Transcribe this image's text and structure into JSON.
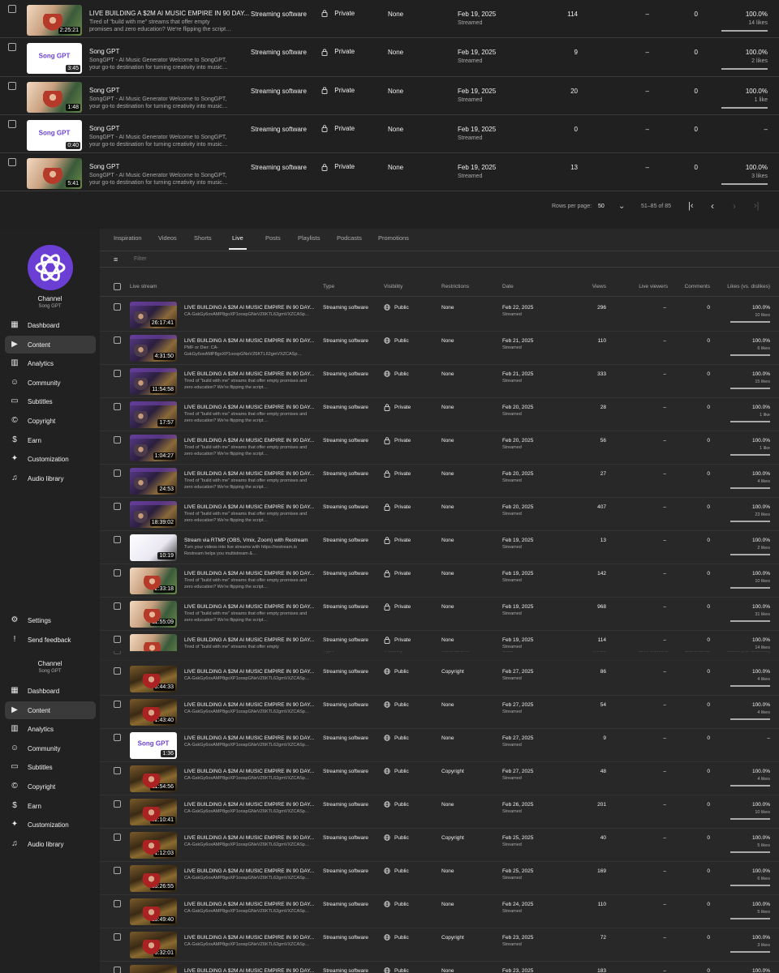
{
  "top_table": {
    "rows": [
      {
        "title": "LIVE BUILDING A $2M AI MUSIC EMPIRE IN 90 DAY...",
        "desc": "Tired of \"build with me\" streams that offer empty promises and zero education? We're flipping the script…",
        "duration": "2:25:21",
        "thumb": "cream",
        "type": "Streaming software",
        "visibility": "Private",
        "restrictions": "None",
        "date": "Feb 19, 2025",
        "date_sub": "Streamed",
        "views": "114",
        "live_viewers": "–",
        "comments": "0",
        "likes": "100.0%",
        "likes_sub": "14 likes",
        "ratio": 1
      },
      {
        "title": "Song GPT",
        "desc": "SongGPT - AI Music Generator Welcome to SongGPT, your go-to destination for turning creativity into music…",
        "duration": "3:45",
        "thumb": "logo",
        "type": "Streaming software",
        "visibility": "Private",
        "restrictions": "None",
        "date": "Feb 19, 2025",
        "date_sub": "Streamed",
        "views": "9",
        "live_viewers": "–",
        "comments": "0",
        "likes": "100.0%",
        "likes_sub": "2 likes",
        "ratio": 1
      },
      {
        "title": "Song GPT",
        "desc": "SongGPT - AI Music Generator Welcome to SongGPT, your go-to destination for turning creativity into music…",
        "duration": "1:48",
        "thumb": "cream",
        "type": "Streaming software",
        "visibility": "Private",
        "restrictions": "None",
        "date": "Feb 19, 2025",
        "date_sub": "Streamed",
        "views": "20",
        "live_viewers": "–",
        "comments": "0",
        "likes": "100.0%",
        "likes_sub": "1 like",
        "ratio": 1
      },
      {
        "title": "Song GPT",
        "desc": "SongGPT - AI Music Generator Welcome to SongGPT, your go-to destination for turning creativity into music…",
        "duration": "0:40",
        "thumb": "logo",
        "type": "Streaming software",
        "visibility": "Private",
        "restrictions": "None",
        "date": "Feb 19, 2025",
        "date_sub": "Streamed",
        "views": "0",
        "live_viewers": "–",
        "comments": "0",
        "likes": "–",
        "likes_sub": "",
        "ratio": null
      },
      {
        "title": "Song GPT",
        "desc": "SongGPT - AI Music Generator Welcome to SongGPT, your go-to destination for turning creativity into music…",
        "duration": "5:41",
        "thumb": "cream",
        "type": "Streaming software",
        "visibility": "Private",
        "restrictions": "None",
        "date": "Feb 19, 2025",
        "date_sub": "Streamed",
        "views": "13",
        "live_viewers": "–",
        "comments": "0",
        "likes": "100.0%",
        "likes_sub": "3 likes",
        "ratio": 1
      }
    ],
    "pager": {
      "rows_per_page_label": "Rows per page:",
      "rows_per_page": "50",
      "range": "51–85 of 85"
    }
  },
  "logo_text": "Song GPT",
  "channel": {
    "label": "Channel",
    "name": "Song GPT"
  },
  "nav": [
    {
      "label": "Dashboard",
      "icon": "dashboard-icon",
      "glyph": "▦"
    },
    {
      "label": "Content",
      "icon": "content-icon",
      "glyph": "▶"
    },
    {
      "label": "Analytics",
      "icon": "analytics-icon",
      "glyph": "▥"
    },
    {
      "label": "Community",
      "icon": "community-icon",
      "glyph": "☺"
    },
    {
      "label": "Subtitles",
      "icon": "subtitles-icon",
      "glyph": "▭"
    },
    {
      "label": "Copyright",
      "icon": "copyright-icon",
      "glyph": "©"
    },
    {
      "label": "Earn",
      "icon": "earn-icon",
      "glyph": "$"
    },
    {
      "label": "Customization",
      "icon": "customization-icon",
      "glyph": "✦"
    },
    {
      "label": "Audio library",
      "icon": "audio-library-icon",
      "glyph": "♫"
    }
  ],
  "nav_bottom": [
    {
      "label": "Settings",
      "icon": "settings-icon",
      "glyph": "⚙"
    },
    {
      "label": "Send feedback",
      "icon": "feedback-icon",
      "glyph": "!"
    }
  ],
  "tabs": [
    "Inspiration",
    "Videos",
    "Shorts",
    "Live",
    "Posts",
    "Playlists",
    "Podcasts",
    "Promotions"
  ],
  "active_tab": "Live",
  "filter_placeholder": "Filter",
  "columns": {
    "live_stream": "Live stream",
    "type": "Type",
    "visibility": "Visibility",
    "restrictions": "Restrictions",
    "date": "Date",
    "views": "Views",
    "live_viewers": "Live viewers",
    "comments": "Comments",
    "likes": "Likes (vs. dislikes)"
  },
  "panel1_rows": [
    {
      "title": "LIVE BUILDING A $2M AI MUSIC EMPIRE IN 90 DAY...",
      "desc": "CA-GskGy6oxAMP8goXP1oospGNeVZ6KTL62gmVXZCASp…",
      "duration": "26:17:41",
      "thumb": "live",
      "type": "Streaming software",
      "visibility": "Public",
      "restrictions": "None",
      "date": "Feb 22, 2025",
      "date_sub": "Streamed",
      "views": "296",
      "live_viewers": "–",
      "comments": "0",
      "likes": "100.0%",
      "likes_sub": "10 likes",
      "ratio": 1
    },
    {
      "title": "LIVE BUILDING A $2M AI MUSIC EMPIRE IN 90 DAY...",
      "desc": "PMF or Dier: CA-GskGy6oxAMP8goXP1oospGNeVZ6KTL62gmVXZCASp…",
      "duration": "4:31:50",
      "thumb": "live",
      "type": "Streaming software",
      "visibility": "Public",
      "restrictions": "None",
      "date": "Feb 21, 2025",
      "date_sub": "Streamed",
      "views": "110",
      "live_viewers": "–",
      "comments": "0",
      "likes": "100.0%",
      "likes_sub": "6 likes",
      "ratio": 1
    },
    {
      "title": "LIVE BUILDING A $2M AI MUSIC EMPIRE IN 90 DAY...",
      "desc": "Tired of \"build with me\" streams that offer empty promises and zero education? We're flipping the script…",
      "duration": "11:54:58",
      "thumb": "live",
      "type": "Streaming software",
      "visibility": "Public",
      "restrictions": "None",
      "date": "Feb 21, 2025",
      "date_sub": "Streamed",
      "views": "333",
      "live_viewers": "–",
      "comments": "0",
      "likes": "100.0%",
      "likes_sub": "15 likes",
      "ratio": 1
    },
    {
      "title": "LIVE BUILDING A $2M AI MUSIC EMPIRE IN 90 DAY...",
      "desc": "Tired of \"build with me\" streams that offer empty promises and zero education? We're flipping the script…",
      "duration": "17:57",
      "thumb": "live",
      "type": "Streaming software",
      "visibility": "Private",
      "restrictions": "None",
      "date": "Feb 20, 2025",
      "date_sub": "Streamed",
      "views": "28",
      "live_viewers": "–",
      "comments": "0",
      "likes": "100.0%",
      "likes_sub": "1 like",
      "ratio": 1
    },
    {
      "title": "LIVE BUILDING A $2M AI MUSIC EMPIRE IN 90 DAY...",
      "desc": "Tired of \"build with me\" streams that offer empty promises and zero education? We're flipping the script…",
      "duration": "1:04:27",
      "thumb": "live",
      "type": "Streaming software",
      "visibility": "Private",
      "restrictions": "None",
      "date": "Feb 20, 2025",
      "date_sub": "Streamed",
      "views": "56",
      "live_viewers": "–",
      "comments": "0",
      "likes": "100.0%",
      "likes_sub": "1 like",
      "ratio": 1
    },
    {
      "title": "LIVE BUILDING A $2M AI MUSIC EMPIRE IN 90 DAY...",
      "desc": "Tired of \"build with me\" streams that offer empty promises and zero education? We're flipping the script…",
      "duration": "24:53",
      "thumb": "live",
      "type": "Streaming software",
      "visibility": "Private",
      "restrictions": "None",
      "date": "Feb 20, 2025",
      "date_sub": "Streamed",
      "views": "27",
      "live_viewers": "–",
      "comments": "0",
      "likes": "100.0%",
      "likes_sub": "4 likes",
      "ratio": 1
    },
    {
      "title": "LIVE BUILDING A $2M AI MUSIC EMPIRE IN 90 DAY...",
      "desc": "Tired of \"build with me\" streams that offer empty promises and zero education? We're flipping the script…",
      "duration": "18:39:02",
      "thumb": "live",
      "type": "Streaming software",
      "visibility": "Private",
      "restrictions": "None",
      "date": "Feb 20, 2025",
      "date_sub": "Streamed",
      "views": "407",
      "live_viewers": "–",
      "comments": "0",
      "likes": "100.0%",
      "likes_sub": "23 likes",
      "ratio": 1
    },
    {
      "title": "Stream via RTMP (OBS, Vmix, Zoom) with Restream",
      "desc": "Turn your videos into live streams with https://restream.io Restream helps you multistream &…",
      "duration": "10:19",
      "thumb": "white",
      "type": "Streaming software",
      "visibility": "Private",
      "restrictions": "None",
      "date": "Feb 19, 2025",
      "date_sub": "Streamed",
      "views": "13",
      "live_viewers": "–",
      "comments": "0",
      "likes": "100.0%",
      "likes_sub": "2 likes",
      "ratio": 1
    },
    {
      "title": "LIVE BUILDING A $2M AI MUSIC EMPIRE IN 90 DAY...",
      "desc": "Tired of \"build with me\" streams that offer empty promises and zero education? We're flipping the script…",
      "duration": "2:33:18",
      "thumb": "cream",
      "type": "Streaming software",
      "visibility": "Private",
      "restrictions": "None",
      "date": "Feb 19, 2025",
      "date_sub": "Streamed",
      "views": "142",
      "live_viewers": "–",
      "comments": "0",
      "likes": "100.0%",
      "likes_sub": "10 likes",
      "ratio": 1
    },
    {
      "title": "LIVE BUILDING A $2M AI MUSIC EMPIRE IN 90 DAY...",
      "desc": "Tired of \"build with me\" streams that offer empty promises and zero education? We're flipping the script…",
      "duration": "11:55:09",
      "thumb": "cream",
      "type": "Streaming software",
      "visibility": "Private",
      "restrictions": "None",
      "date": "Feb 19, 2025",
      "date_sub": "Streamed",
      "views": "968",
      "live_viewers": "–",
      "comments": "0",
      "likes": "100.0%",
      "likes_sub": "31 likes",
      "ratio": 1
    },
    {
      "title": "LIVE BUILDING A $2M AI MUSIC EMPIRE IN 90 DAY...",
      "desc": "Tired of \"build with me\" streams that offer empty",
      "duration": "",
      "thumb": "cream",
      "type": "Streaming software",
      "visibility": "Private",
      "restrictions": "None",
      "date": "Feb 19, 2025",
      "date_sub": "Streamed",
      "views": "114",
      "live_viewers": "–",
      "comments": "0",
      "likes": "100.0%",
      "likes_sub": "14 likes",
      "ratio": 1
    }
  ],
  "panel2_rows": [
    {
      "title": "LIVE BUILDING A $2M AI MUSIC EMPIRE IN 90 DAY...",
      "desc": "CA-GskGy6oxAMP8goXP1oospGNeVZ6KTL62gmVXZCASp…",
      "duration": "8:44:33",
      "thumb": "room",
      "type": "Streaming software",
      "visibility": "Public",
      "restrictions": "Copyright",
      "date": "Feb 27, 2025",
      "date_sub": "Streamed",
      "views": "86",
      "live_viewers": "–",
      "comments": "0",
      "likes": "100.0%",
      "likes_sub": "4 likes",
      "ratio": 1
    },
    {
      "title": "LIVE BUILDING A $2M AI MUSIC EMPIRE IN 90 DAY...",
      "desc": "CA-GskGy6oxAMP8goXP1oospGNeVZ6KTL62gmVXZCASp…",
      "duration": "1:43:40",
      "thumb": "room",
      "type": "Streaming software",
      "visibility": "Public",
      "restrictions": "None",
      "date": "Feb 27, 2025",
      "date_sub": "Streamed",
      "views": "54",
      "live_viewers": "–",
      "comments": "0",
      "likes": "100.0%",
      "likes_sub": "4 likes",
      "ratio": 1
    },
    {
      "title": "LIVE BUILDING A $2M AI MUSIC EMPIRE IN 90 DAY...",
      "desc": "CA-GskGy6oxAMP8goXP1oospGNeVZ6KTL62gmVXZCASp…",
      "duration": "1:36",
      "thumb": "logo",
      "type": "Streaming software",
      "visibility": "Public",
      "restrictions": "None",
      "date": "Feb 27, 2025",
      "date_sub": "Streamed",
      "views": "9",
      "live_viewers": "–",
      "comments": "0",
      "likes": "–",
      "likes_sub": "",
      "ratio": null
    },
    {
      "title": "LIVE BUILDING A $2M AI MUSIC EMPIRE IN 90 DAY...",
      "desc": "CA-GskGy6oxAMP8goXP1oospGNeVZ6KTL62gmVXZCASp…",
      "duration": "11:54:56",
      "thumb": "room",
      "type": "Streaming software",
      "visibility": "Public",
      "restrictions": "Copyright",
      "date": "Feb 27, 2025",
      "date_sub": "Streamed",
      "views": "48",
      "live_viewers": "–",
      "comments": "0",
      "likes": "100.0%",
      "likes_sub": "4 likes",
      "ratio": 1
    },
    {
      "title": "LIVE BUILDING A $2M AI MUSIC EMPIRE IN 90 DAY...",
      "desc": "CA-GskGy6oxAMP8goXP1oospGNeVZ6KTL62gmVXZCASp…",
      "duration": "32:10:41",
      "thumb": "room",
      "type": "Streaming software",
      "visibility": "Public",
      "restrictions": "None",
      "date": "Feb 26, 2025",
      "date_sub": "Streamed",
      "views": "201",
      "live_viewers": "–",
      "comments": "0",
      "likes": "100.0%",
      "likes_sub": "10 likes",
      "ratio": 1
    },
    {
      "title": "LIVE BUILDING A $2M AI MUSIC EMPIRE IN 90 DAY...",
      "desc": "CA-GskGy6oxAMP8goXP1oospGNeVZ6KTL62gmVXZCASp…",
      "duration": "1:12:03",
      "thumb": "room",
      "type": "Streaming software",
      "visibility": "Public",
      "restrictions": "Copyright",
      "date": "Feb 25, 2025",
      "date_sub": "Streamed",
      "views": "40",
      "live_viewers": "–",
      "comments": "0",
      "likes": "100.0%",
      "likes_sub": "5 likes",
      "ratio": 1
    },
    {
      "title": "LIVE BUILDING A $2M AI MUSIC EMPIRE IN 90 DAY...",
      "desc": "CA-GskGy6oxAMP8goXP1oospGNeVZ6KTL62gmVXZCASp…",
      "duration": "23:26:55",
      "thumb": "room",
      "type": "Streaming software",
      "visibility": "Public",
      "restrictions": "None",
      "date": "Feb 25, 2025",
      "date_sub": "Streamed",
      "views": "169",
      "live_viewers": "–",
      "comments": "0",
      "likes": "100.0%",
      "likes_sub": "6 likes",
      "ratio": 1
    },
    {
      "title": "LIVE BUILDING A $2M AI MUSIC EMPIRE IN 90 DAY...",
      "desc": "CA-GskGy6oxAMP8goXP1oospGNeVZ6KTL62gmVXZCASp…",
      "duration": "18:49:40",
      "thumb": "room",
      "type": "Streaming software",
      "visibility": "Public",
      "restrictions": "None",
      "date": "Feb 24, 2025",
      "date_sub": "Streamed",
      "views": "110",
      "live_viewers": "–",
      "comments": "0",
      "likes": "100.0%",
      "likes_sub": "5 likes",
      "ratio": 1
    },
    {
      "title": "LIVE BUILDING A $2M AI MUSIC EMPIRE IN 90 DAY...",
      "desc": "CA-GskGy6oxAMP8goXP1oospGNeVZ6KTL62gmVXZCASp…",
      "duration": "5:32:01",
      "thumb": "room",
      "type": "Streaming software",
      "visibility": "Public",
      "restrictions": "Copyright",
      "date": "Feb 23, 2025",
      "date_sub": "Streamed",
      "views": "72",
      "live_viewers": "–",
      "comments": "0",
      "likes": "100.0%",
      "likes_sub": "3 likes",
      "ratio": 1
    },
    {
      "title": "LIVE BUILDING A $2M AI MUSIC EMPIRE IN 90 DAY...",
      "desc": "",
      "duration": "",
      "thumb": "room",
      "type": "Streaming software",
      "visibility": "Public",
      "restrictions": "None",
      "date": "Feb 23, 2025",
      "date_sub": "",
      "views": "183",
      "live_viewers": "–",
      "comments": "0",
      "likes": "100.0%",
      "likes_sub": "",
      "ratio": 1
    }
  ],
  "colors": {
    "background": "#202020",
    "panel": "#282828",
    "text": "#f1f1f1",
    "muted": "#aaaaaa",
    "brand": "#6b3fd4"
  }
}
